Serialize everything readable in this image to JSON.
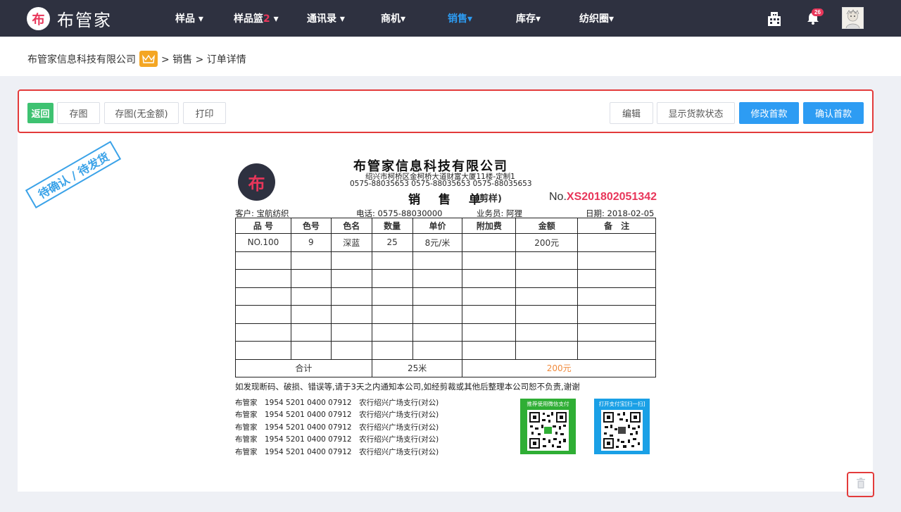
{
  "app": {
    "logo_mark": "布",
    "name": "布管家"
  },
  "nav": {
    "items": [
      {
        "label": "样品 ▾"
      },
      {
        "label": "样品篮"
      },
      {
        "label": "通讯录 ▾"
      },
      {
        "label": "商机▾"
      },
      {
        "label": "销售▾"
      },
      {
        "label": "库存▾"
      },
      {
        "label": "纺织圈▾"
      }
    ],
    "basket_count": "2",
    "basket_caret": " ▾",
    "notifications": "26",
    "active_color": "#2d9cf3"
  },
  "breadcrumb": {
    "company": "布管家信息科技有限公司",
    "path": "> 销售 > 订单详情"
  },
  "toolbar": {
    "back": "返回",
    "save_image": "存图",
    "save_image_no_amount": "存图(无金额)",
    "print": "打印",
    "edit": "编辑",
    "show_payment_status": "显示货款状态",
    "modify_first_payment": "修改首款",
    "confirm_first_payment": "确认首款"
  },
  "stamp": "待确认 / 待发货",
  "invoice": {
    "logo_mark": "布",
    "company": "布管家信息科技有限公司",
    "address": "绍兴市柯桥区金柯桥大道财富大厦11楼-定制1",
    "phones": "0575-88035653  0575-88035653  0575-88035653",
    "title": "销 售 单",
    "subtitle": "(剪样)",
    "no_prefix": "No.",
    "no": "XS201802051342",
    "customer": "客户: 宝航纺织",
    "phone": "电话: 0575-88030000",
    "salesman": "业务员: 阿狸",
    "date": "日期: 2018-02-05",
    "headers": [
      "品 号",
      "色号",
      "色名",
      "数量",
      "单价",
      "附加费",
      "金额",
      "备　注"
    ],
    "rows": [
      [
        "NO.100",
        "9",
        "深蓝",
        "25",
        "8元/米",
        "",
        "200元",
        ""
      ],
      [
        "",
        "",
        "",
        "",
        "",
        "",
        "",
        ""
      ],
      [
        "",
        "",
        "",
        "",
        "",
        "",
        "",
        ""
      ],
      [
        "",
        "",
        "",
        "",
        "",
        "",
        "",
        ""
      ],
      [
        "",
        "",
        "",
        "",
        "",
        "",
        "",
        ""
      ],
      [
        "",
        "",
        "",
        "",
        "",
        "",
        "",
        ""
      ],
      [
        "",
        "",
        "",
        "",
        "",
        "",
        "",
        ""
      ]
    ],
    "total_label": "合计",
    "total_qty": "25米",
    "total_amount": "200元",
    "notice": "如发现断码、破损、错误等,请于3天之内通知本公司,如经剪裁或其他后整理本公司恕不负责,谢谢",
    "bank_lines": [
      "布管家　1954 5201 0400 07912　农行绍兴广场支行(对公)",
      "布管家　1954 5201 0400 07912　农行绍兴广场支行(对公)",
      "布管家　1954 5201 0400 07912　农行绍兴广场支行(对公)",
      "布管家　1954 5201 0400 07912　农行绍兴广场支行(对公)",
      "布管家　1954 5201 0400 07912　农行绍兴广场支行(对公)"
    ],
    "qr_wechat": "推荐使用微信支付",
    "qr_alipay": "打开支付宝[扫一扫]"
  }
}
